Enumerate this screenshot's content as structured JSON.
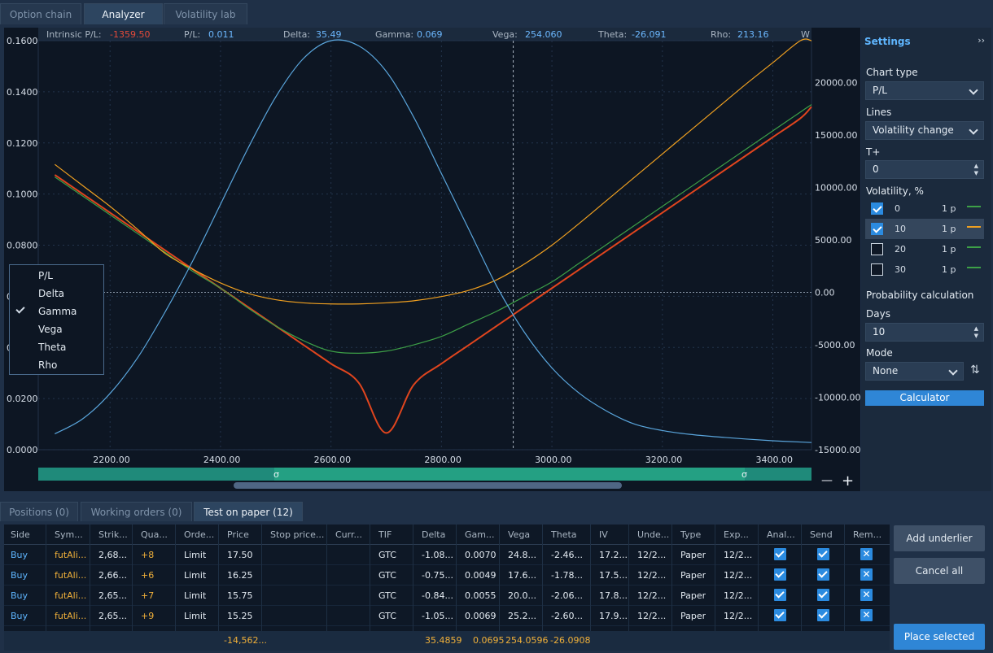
{
  "tabs": [
    "Option chain",
    "Analyzer",
    "Volatility lab"
  ],
  "greeks_bar": {
    "intrinsic_label": "Intrinsic P/L:",
    "intrinsic_value": "-1359.50",
    "pl_label": "P/L:",
    "pl_value": "0.011",
    "delta_label": "Delta:",
    "delta_value": "35.49",
    "gamma_label": "Gamma:",
    "gamma_value": "0.069",
    "vega_label": "Vega:",
    "vega_value": "254.060",
    "theta_label": "Theta:",
    "theta_value": "-26.091",
    "rho_label": "Rho:",
    "rho_value": "213.16",
    "w": "W"
  },
  "chart_data": {
    "type": "line",
    "x": [
      2100,
      2150,
      2200,
      2250,
      2300,
      2350,
      2400,
      2450,
      2500,
      2550,
      2600,
      2650,
      2700,
      2750,
      2800,
      2850,
      2900,
      2950,
      3000,
      3050,
      3100,
      3150,
      3200,
      3250,
      3300,
      3350,
      3400,
      3450,
      3470
    ],
    "left_ylim": [
      0,
      0.16
    ],
    "right_ylim": [
      -15000,
      24000
    ],
    "left_ticks": [
      "0.0000",
      "0.0200",
      "0.0400",
      "0.0600",
      "0.0800",
      "0.1000",
      "0.1200",
      "0.1400",
      "0.1600"
    ],
    "right_ticks": [
      "-15000.00",
      "-10000.00",
      "-5000.00",
      "0.00",
      "5000.00",
      "10000.00",
      "15000.00",
      "20000.00"
    ],
    "x_ticks": [
      "2200.00",
      "2400.00",
      "2600.00",
      "2800.00",
      "3000.00",
      "3200.00",
      "3400.00"
    ],
    "series": [
      {
        "color": "#e0451e",
        "axis": "right",
        "values": [
          11200,
          9400,
          7600,
          5800,
          4000,
          2200,
          400,
          -1400,
          -3200,
          -5000,
          -6800,
          -8600,
          -13400,
          -8800,
          -6800,
          -5000,
          -3200,
          -1400,
          400,
          2200,
          4000,
          5800,
          7600,
          9400,
          11200,
          13000,
          14800,
          16600,
          17700
        ]
      },
      {
        "color": "#3da047",
        "axis": "right",
        "values": [
          11000,
          9200,
          7400,
          5600,
          3800,
          2000,
          400,
          -1500,
          -3200,
          -4600,
          -5600,
          -5800,
          -5600,
          -5000,
          -4200,
          -3000,
          -1800,
          -400,
          1000,
          2800,
          4600,
          6400,
          8200,
          10000,
          11800,
          13600,
          15400,
          17200,
          17900
        ]
      },
      {
        "color": "#f0a020",
        "axis": "right",
        "values": [
          12200,
          10200,
          8200,
          6000,
          3700,
          2200,
          900,
          -100,
          -700,
          -1000,
          -1100,
          -1100,
          -1000,
          -800,
          -400,
          200,
          1200,
          2700,
          4500,
          6600,
          8800,
          11000,
          13200,
          15400,
          17600,
          19800,
          21900,
          24000,
          24000
        ]
      },
      {
        "color": "#5aa6dd",
        "axis": "left",
        "values": [
          0.0062,
          0.012,
          0.022,
          0.036,
          0.054,
          0.074,
          0.096,
          0.118,
          0.138,
          0.153,
          0.16,
          0.158,
          0.148,
          0.13,
          0.108,
          0.086,
          0.064,
          0.046,
          0.032,
          0.022,
          0.015,
          0.01,
          0.0075,
          0.006,
          0.005,
          0.0042,
          0.0035,
          0.003,
          0.0028
        ]
      }
    ],
    "cursor_x": 2930,
    "grid": true
  },
  "sigma": "σ",
  "zoom": {
    "minus": "—",
    "plus": "+"
  },
  "context_menu": [
    "P/L",
    "Delta",
    "Gamma",
    "Vega",
    "Theta",
    "Rho"
  ],
  "settings": {
    "title": "Settings",
    "collapse": "››",
    "chart_type_label": "Chart type",
    "chart_type": "P/L",
    "lines_label": "Lines",
    "lines": "Volatility change",
    "tplus_label": "T+",
    "tplus": "0",
    "vol_label": "Volatility, %",
    "vols": [
      {
        "v": "0",
        "p": "1 p",
        "color": "#3da047"
      },
      {
        "v": "10",
        "p": "1 p",
        "color": "#f0a020"
      },
      {
        "v": "20",
        "p": "1 p",
        "color": "#3da047"
      },
      {
        "v": "30",
        "p": "1 p",
        "color": "#3da047"
      }
    ],
    "prob_label": "Probability calculation",
    "days_label": "Days",
    "days": "10",
    "mode_label": "Mode",
    "mode": "None",
    "calculator": "Calculator"
  },
  "bottom_tabs": [
    "Positions (0)",
    "Working orders (0)",
    "Test on paper (12)"
  ],
  "columns": [
    "Side",
    "Sym...",
    "Strik...",
    "Qua...",
    "Orde...",
    "Price",
    "Stop price...",
    "Curr...",
    "TIF",
    "Delta",
    "Gam...",
    "Vega",
    "Theta",
    "IV",
    "Unde...",
    "Type",
    "Exp...",
    "Anal...",
    "Send",
    "Rem..."
  ],
  "rows": [
    [
      "Buy",
      "futAli...",
      "2,68...",
      "+8",
      "Limit",
      "17.50",
      "",
      "",
      "GTC",
      "-1.08...",
      "0.0070",
      "24.8...",
      "-2.46...",
      "17.2...",
      "12/2...",
      "Paper",
      "12/2..."
    ],
    [
      "Buy",
      "futAli...",
      "2,66...",
      "+6",
      "Limit",
      "16.25",
      "",
      "",
      "GTC",
      "-0.75...",
      "0.0049",
      "17.6...",
      "-1.78...",
      "17.5...",
      "12/2...",
      "Paper",
      "12/2..."
    ],
    [
      "Buy",
      "futAli...",
      "2,65...",
      "+7",
      "Limit",
      "15.75",
      "",
      "",
      "GTC",
      "-0.84...",
      "0.0055",
      "20.0...",
      "-2.06...",
      "17.8...",
      "12/2...",
      "Paper",
      "12/2..."
    ],
    [
      "Buy",
      "futAli...",
      "2,65...",
      "+9",
      "Limit",
      "15.25",
      "",
      "",
      "GTC",
      "-1.05...",
      "0.0069",
      "25.2...",
      "-2.60...",
      "17.9...",
      "12/2...",
      "Paper",
      "12/2..."
    ]
  ],
  "totals": {
    "price": "-14,562...",
    "delta": "35.4859",
    "gamma": "0.0695",
    "vega": "254.0596",
    "theta": "-26.0908"
  },
  "actions": {
    "add_underlier": "Add underlier",
    "cancel_all": "Cancel all",
    "place_selected": "Place selected"
  }
}
